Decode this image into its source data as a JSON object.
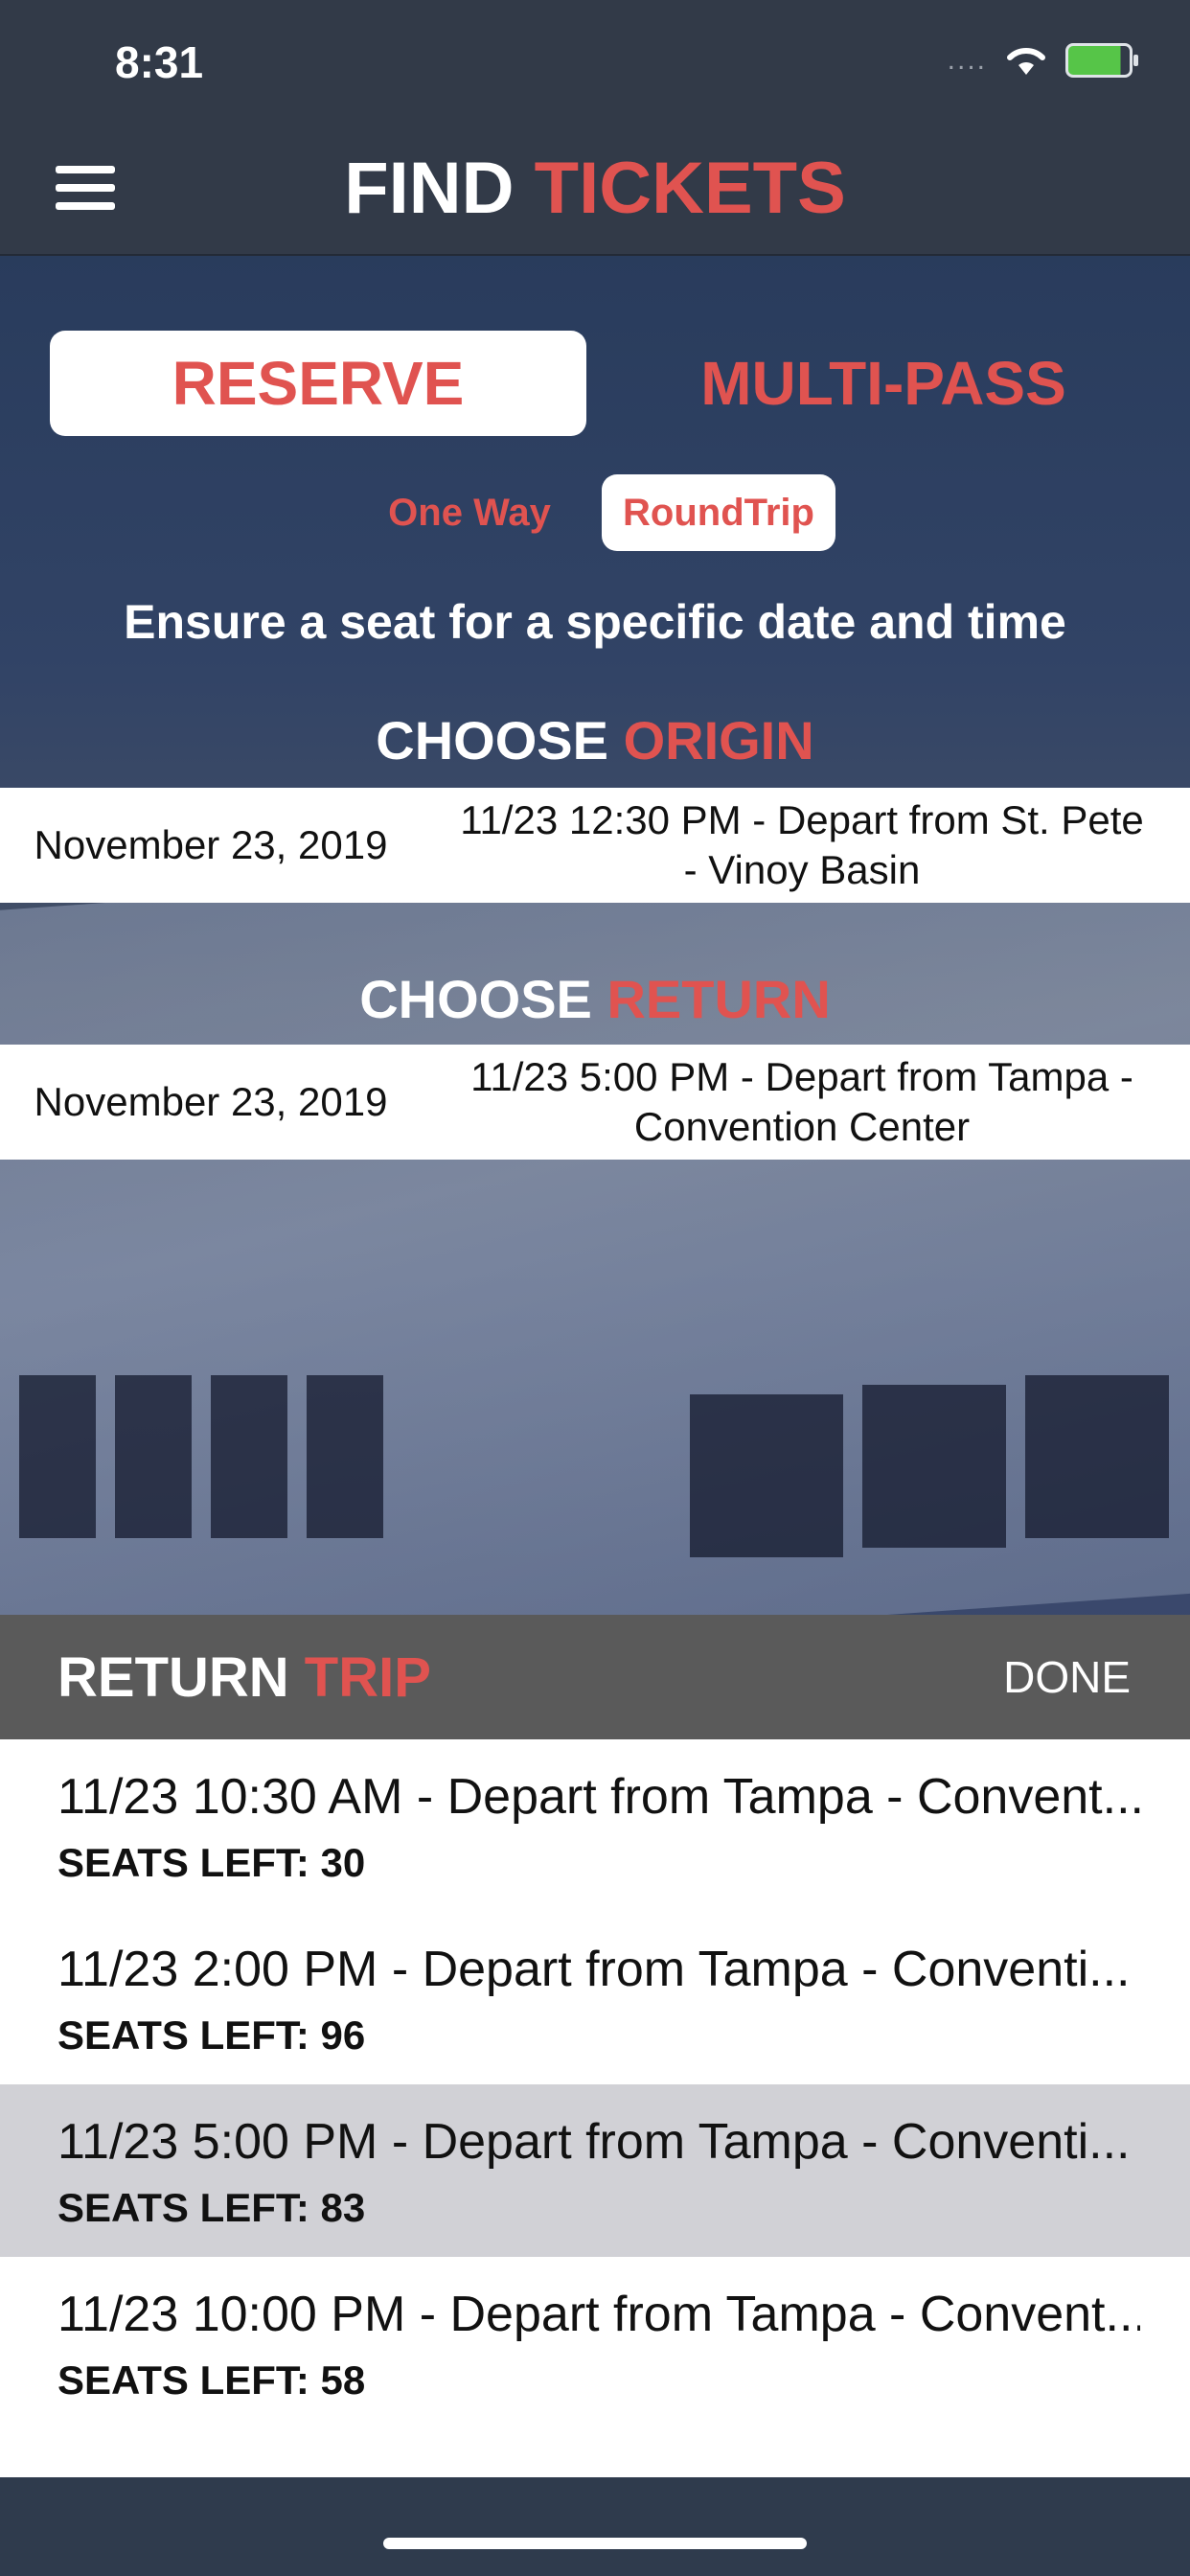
{
  "status_bar": {
    "time": "8:31",
    "signal": "....",
    "wifi_icon": "wifi-icon",
    "battery_icon": "battery-charging-icon"
  },
  "nav": {
    "title_part1": "FIND",
    "title_part2": "TICKETS",
    "menu_icon": "hamburger-menu-icon"
  },
  "mode_tabs": {
    "reserve": "RESERVE",
    "multipass": "MULTI-PASS",
    "selected": "RESERVE"
  },
  "trip_type": {
    "one_way": "One Way",
    "round_trip": "RoundTrip",
    "selected": "RoundTrip"
  },
  "tagline": "Ensure a seat for a specific date and time",
  "origin": {
    "title_part1": "CHOOSE",
    "title_part2": "ORIGIN",
    "date": "November 23, 2019",
    "trip_line1": "11/23 12:30 PM - Depart from St. Pete",
    "trip_line2": "- Vinoy Basin"
  },
  "return": {
    "title_part1": "CHOOSE",
    "title_part2": "RETURN",
    "date": "November 23, 2019",
    "trip_line1": "11/23 5:00 PM - Depart from Tampa -",
    "trip_line2": "Convention Center"
  },
  "sheet": {
    "title_part1": "RETURN",
    "title_part2": "TRIP",
    "done": "DONE",
    "items": [
      {
        "title": "11/23 10:30 AM - Depart from Tampa - Convent...",
        "seats": "SEATS LEFT: 30"
      },
      {
        "title": "11/23 2:00 PM - Depart from Tampa - Conventi...",
        "seats": "SEATS LEFT: 96"
      },
      {
        "title": "11/23 5:00 PM - Depart from Tampa - Conventi...",
        "seats": "SEATS LEFT: 83"
      },
      {
        "title": "11/23 10:00 PM - Depart from Tampa - Convent...",
        "seats": "SEATS LEFT: 58"
      }
    ]
  },
  "colors": {
    "accent": "#e05350",
    "nav_bg": "#323a48",
    "sheet_header_bg": "#5a5a5a",
    "selected_row": "#d1d1d6"
  }
}
